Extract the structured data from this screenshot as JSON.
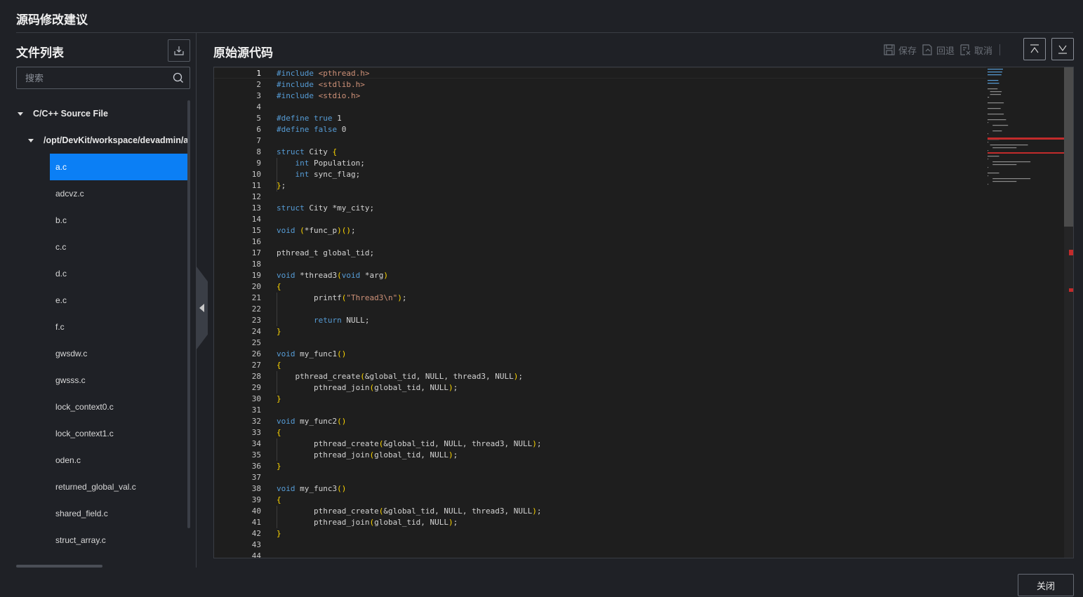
{
  "dialog": {
    "title": "源码修改建议",
    "close_label": "关闭"
  },
  "file_panel": {
    "title": "文件列表",
    "search_placeholder": "搜索",
    "tree": {
      "root_label": "C/C++ Source File",
      "path_label": "/opt/DevKit/workspace/devadmin/a",
      "files": [
        "a.c",
        "adcvz.c",
        "b.c",
        "c.c",
        "d.c",
        "e.c",
        "f.c",
        "gwsdw.c",
        "gwsss.c",
        "lock_context0.c",
        "lock_context1.c",
        "oden.c",
        "returned_global_val.c",
        "shared_field.c",
        "struct_array.c"
      ],
      "selected": "a.c"
    }
  },
  "code_panel": {
    "title": "原始源代码",
    "toolbar": {
      "save_label": "保存",
      "revert_label": "回退",
      "cancel_label": "取消"
    },
    "colors": {
      "keyword": "#569cd6",
      "string": "#ce9178",
      "bracket": "#ffd700",
      "text": "#d4d4d4",
      "error": "#c22b2b",
      "selection": "#0b7ff5"
    },
    "lines": [
      "#include <pthread.h>",
      "#include <stdlib.h>",
      "#include <stdio.h>",
      "",
      "#define true 1",
      "#define false 0",
      "",
      "struct City {",
      "    int Population;",
      "    int sync_flag;",
      "};",
      "",
      "struct City *my_city;",
      "",
      "void (*func_p)();",
      "",
      "pthread_t global_tid;",
      "",
      "void *thread3(void *arg)",
      "{",
      "        printf(\"Thread3\\n\");",
      "",
      "        return NULL;",
      "}",
      "",
      "void my_func1()",
      "{",
      "    pthread_create(&global_tid, NULL, thread3, NULL);",
      "        pthread_join(global_tid, NULL);",
      "}",
      "",
      "void my_func2()",
      "{",
      "        pthread_create(&global_tid, NULL, thread3, NULL);",
      "        pthread_join(global_tid, NULL);",
      "}",
      "",
      "void my_func3()",
      "{",
      "        pthread_create(&global_tid, NULL, thread3, NULL);",
      "        pthread_join(global_tid, NULL);",
      "}",
      "",
      ""
    ]
  }
}
